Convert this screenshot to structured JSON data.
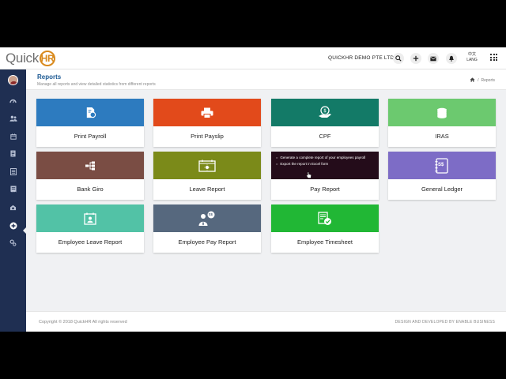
{
  "app": {
    "logo_text": "Quick",
    "logo_badge": "HR",
    "company": "QUICKHR DEMO PTE LTD",
    "lang_top": "中文",
    "lang_bottom": "LANG"
  },
  "topbar_icons": [
    "search-icon",
    "plus-icon",
    "mail-icon",
    "bell-icon",
    "apps-grid-icon"
  ],
  "sidebar": {
    "items": [
      "dashboard-icon",
      "users-icon",
      "calendar-icon",
      "document-icon",
      "document-list-icon",
      "payslip-icon",
      "money-icon",
      "reports-icon",
      "settings-icon"
    ],
    "active": "reports-icon"
  },
  "header": {
    "title": "Reports",
    "subtitle": "Manage all reports and view detailed statistics from different reports",
    "breadcrumb": "Reports"
  },
  "cards": [
    {
      "label": "Print Payroll",
      "color": "#2d7bbf",
      "icon": "payroll-icon"
    },
    {
      "label": "Print Payslip",
      "color": "#e24a1b",
      "icon": "printer-icon"
    },
    {
      "label": "CPF",
      "color": "#137a67",
      "icon": "cpf-icon"
    },
    {
      "label": "IRAS",
      "color": "#6cc96f",
      "icon": "coin-stack-icon"
    },
    {
      "label": "Bank Giro",
      "color": "#7a4d44",
      "icon": "hierarchy-icon"
    },
    {
      "label": "Leave Report",
      "color": "#7b8a19",
      "icon": "leave-calendar-icon"
    },
    {
      "label": "Pay Report",
      "color": "#240c1a",
      "icon": "pay-report-icon"
    },
    {
      "label": "General Ledger",
      "color": "#7d6cc6",
      "icon": "ledger-icon"
    },
    {
      "label": "Employee Leave Report",
      "color": "#52c2a6",
      "icon": "employee-calendar-icon"
    },
    {
      "label": "Employee Pay Report",
      "color": "#56687e",
      "icon": "employee-pay-icon"
    },
    {
      "label": "Employee Timesheet",
      "color": "#21b735",
      "icon": "timesheet-icon"
    }
  ],
  "pay_report_tooltip": {
    "line1": "Generate a complete report of your employees payroll",
    "line2": "Export the report in Excel form"
  },
  "badges": {
    "ledger": "S$",
    "employee_pay": "S$"
  },
  "footer": {
    "copyright": "Copyright © 2018 QuickHR All rights reserved",
    "credit": "DESIGN AND DEVELOPED BY ENABLE BUSINESS"
  }
}
